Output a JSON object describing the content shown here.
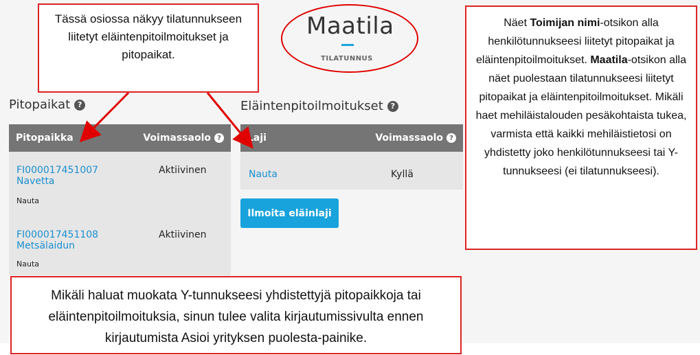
{
  "farm": {
    "title": "Maatila",
    "subtitle": "TILATUNNUS",
    "accent": "#1aa3dd"
  },
  "pitopaikat": {
    "title": "Pitopaikat",
    "headers": [
      "Pitopaikka",
      "Voimassaolo"
    ],
    "rows": [
      {
        "id": "FI000017451007",
        "name": "Navetta",
        "status": "Aktiivinen",
        "species": "Nauta"
      },
      {
        "id": "FI000017451108",
        "name": "Metsälaidun",
        "status": "Aktiivinen",
        "species": "Nauta"
      }
    ]
  },
  "ilmoitukset": {
    "title": "Eläintenpitoilmoitukset",
    "headers": [
      "Laji",
      "Voimassaolo"
    ],
    "rows": [
      {
        "laji": "Nauta",
        "voimassa": "Kyllä"
      }
    ],
    "button_label": "Ilmoita eläinlaji"
  },
  "callouts": {
    "top_left": "Tässä osiossa näkyy tilatunnukseen liitetyt eläintenpitoilmoitukset ja pitopaikat.",
    "right": {
      "p1": "Näet ",
      "b1": "Toimijan nimi",
      "p2": "-otsikon alla henkilötunnukseesi liitetyt pitopaikat ja eläintenpitoilmoitukset. ",
      "b2": "Maatila",
      "p3": "-otsikon alla näet puolestaan tilatunnukseesi liitetyt pitopaikat ja eläintenpitoilmoitukset. Mikäli haet mehiläistalouden pesäkohtaista tukea, varmista että kaikki mehiläistietosi on yhdistetty joko henkilötunnukseesi tai Y-tunnukseesi (ei tilatunnukseesi)."
    },
    "bottom": "Mikäli haluat muokata Y-tunnukseesi yhdistettyjä pitopaikkoja tai eläintenpitoilmoituksia, sinun tulee valita kirjautumissivulta ennen kirjautumista Asioi yrityksen puolesta-painike."
  },
  "colors": {
    "callout_border": "#d22222",
    "table_header": "#757575",
    "table_body": "#e6e6e6",
    "link": "#1a8fd0",
    "button": "#19a3dd"
  },
  "icons": [
    "help-icon"
  ]
}
